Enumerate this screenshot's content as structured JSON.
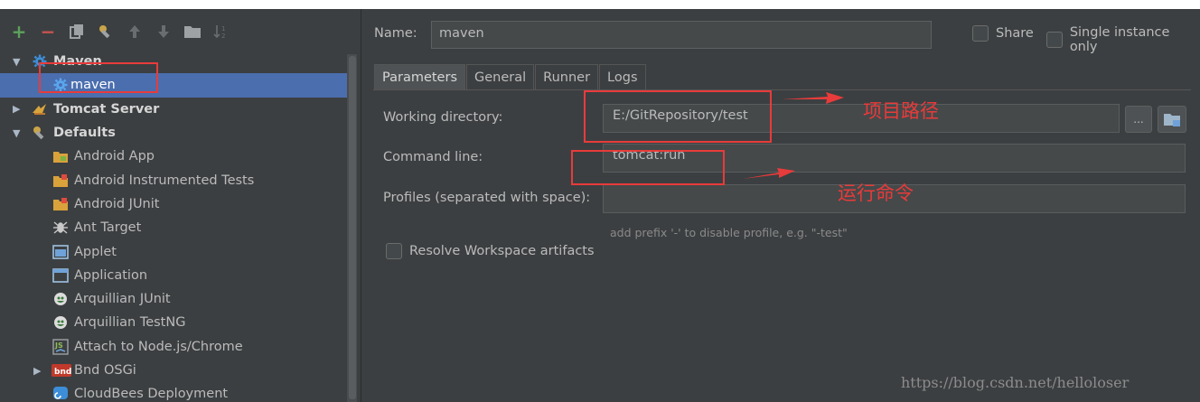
{
  "toolbar": {
    "add": "+",
    "remove": "−"
  },
  "tree": {
    "maven_group": "Maven",
    "maven_item": "maven",
    "tomcat_group": "Tomcat Server",
    "defaults_group": "Defaults",
    "items": [
      "Android App",
      "Android Instrumented Tests",
      "Android JUnit",
      "Ant Target",
      "Applet",
      "Application",
      "Arquillian JUnit",
      "Arquillian TestNG",
      "Attach to Node.js/Chrome",
      "Bnd OSGi",
      "CloudBees Deployment"
    ]
  },
  "config": {
    "name_label": "Name:",
    "name_value": "maven",
    "share_label": "Share",
    "single_instance_label": "Single instance only"
  },
  "tabs": [
    "Parameters",
    "General",
    "Runner",
    "Logs"
  ],
  "parameters": {
    "working_dir_label": "Working directory:",
    "working_dir_value": "E:/GitRepository/test",
    "browse_label": "...",
    "command_line_label": "Command line:",
    "command_line_value": "tomcat:run",
    "profiles_label": "Profiles (separated with space):",
    "profiles_value": "",
    "profiles_hint": "add prefix '-' to disable profile, e.g. \"-test\"",
    "resolve_label": "Resolve Workspace artifacts"
  },
  "annotations": {
    "project_path": "项目路径",
    "run_command": "运行命令"
  },
  "watermark": "https://blog.csdn.net/helloloser",
  "colors": {
    "background": "#3c3f41",
    "selection": "#4b6eaf",
    "annotation_red": "#e83b3b"
  }
}
